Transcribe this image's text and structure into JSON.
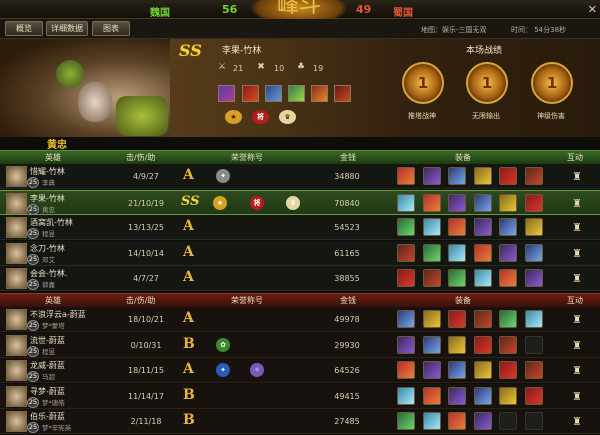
{
  "top": {
    "wei_label": "魏国",
    "wei_score": "56",
    "shu_score": "49",
    "shu_label": "蜀国",
    "logo": "峰斗",
    "close": "✕"
  },
  "tabs": [
    {
      "label": "概览"
    },
    {
      "label": "详细数据"
    },
    {
      "label": "图表"
    }
  ],
  "map_text": "地图：娱乐-三国无双",
  "time_text": "时间： 54分38秒",
  "hero": {
    "rank": "SS",
    "name": "李果-竹林",
    "stats": [
      "21",
      "10",
      "19"
    ],
    "hero_name": "黄忠"
  },
  "record": {
    "title": "本场战绩",
    "medals": [
      {
        "label": "推塔战神",
        "value": "1"
      },
      {
        "label": "无限输出",
        "value": "1"
      },
      {
        "label": "神级伤害",
        "value": "1"
      }
    ]
  },
  "headers": {
    "hero": "英雄",
    "kda": "击/伤/助",
    "honor": "荣誉称号",
    "gold": "金钱",
    "equip": "装备",
    "interact": "互动"
  },
  "wei_players": [
    {
      "name": "惜耀-竹林",
      "sub": "李典",
      "level": "25",
      "kda": "4/9/27",
      "rank": "A",
      "gold": "34880",
      "self": false
    },
    {
      "name": "李果-竹林",
      "sub": "黄忠",
      "level": "25",
      "kda": "21/10/19",
      "rank": "SS",
      "gold": "70840",
      "self": true
    },
    {
      "name": "酒窝凯-竹林",
      "sub": "程昱",
      "level": "25",
      "kda": "13/13/25",
      "rank": "A",
      "gold": "54523",
      "self": false
    },
    {
      "name": "念刀-竹林",
      "sub": "邓艾",
      "level": "25",
      "kda": "14/10/14",
      "rank": "A",
      "gold": "61165",
      "self": false
    },
    {
      "name": "会会-竹林.",
      "sub": "郭嘉",
      "level": "25",
      "kda": "4/7/27",
      "rank": "A",
      "gold": "38855",
      "self": false
    }
  ],
  "shu_players": [
    {
      "name": "不浪浮云a-蔚蓝",
      "sub": "梦*蒙塔",
      "level": "25",
      "kda": "18/10/21",
      "rank": "A",
      "gold": "49978"
    },
    {
      "name": "流世-蔚蓝",
      "sub": "程昱",
      "level": "25",
      "kda": "0/10/31",
      "rank": "B",
      "gold": "29930"
    },
    {
      "name": "龙威-蔚蓝",
      "sub": "马超",
      "level": "25",
      "kda": "18/11/15",
      "rank": "A",
      "gold": "64526"
    },
    {
      "name": "寻梦-蔚蓝",
      "sub": "梦*唐皓",
      "level": "25",
      "kda": "11/14/17",
      "rank": "B",
      "gold": "49415"
    },
    {
      "name": "伯乐-蔚蓝",
      "sub": "梦*辛宪英",
      "level": "25",
      "kda": "2/11/18",
      "rank": "B",
      "gold": "27485"
    }
  ],
  "colors": {
    "wei": "#6fd13a",
    "shu": "#e0553a",
    "accent": "#f0c02c"
  }
}
